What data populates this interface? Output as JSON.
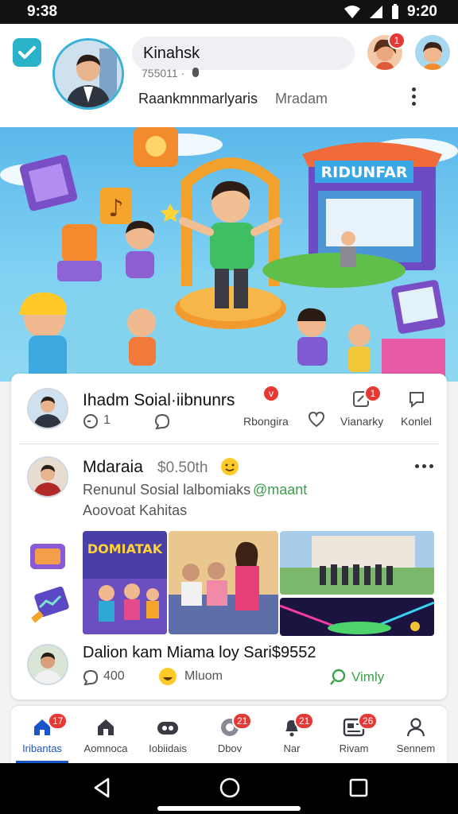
{
  "status_bar": {
    "time_left": "9:38",
    "time_right": "9:20"
  },
  "header": {
    "search_value": "Kinahsk",
    "sub_text": "755011 ·",
    "name": "Raankmnmarlyaris",
    "role": "Mradam",
    "avatar1_badge": "1"
  },
  "banner": {
    "sign": "RIDUNFAR"
  },
  "posts": [
    {
      "title": "Ihadm Soial·iibnunrs",
      "badge": "v",
      "meta_count": "1",
      "action1_label": "Rbongira",
      "action2_label": "Vianarky",
      "action2_badge": "1",
      "action3_label": "Konlel"
    },
    {
      "title": "Mdaraia",
      "title_extra": "$0.50th",
      "line1": "Renunul Sosial lalbomiaks",
      "line1_tag": "@maant",
      "line2": "Aoovoat Kahitas"
    },
    {
      "title": "Dalion kam Miama loy Sari$9552",
      "meta_count": "400",
      "meta_extra": "Mluom",
      "action_label": "Vimly"
    }
  ],
  "media_labels": {
    "poster": "DOMIATAK"
  },
  "bottom_nav": [
    {
      "label": "Iribantas",
      "badge": "17"
    },
    {
      "label": "Aomnoca",
      "badge": ""
    },
    {
      "label": "Iobiidais",
      "badge": ""
    },
    {
      "label": "Dbov",
      "badge": "21"
    },
    {
      "label": "Nar",
      "badge": "21"
    },
    {
      "label": "Rivam",
      "badge": "26"
    },
    {
      "label": "Sennem",
      "badge": ""
    }
  ],
  "colors": {
    "accent": "#1a56c9",
    "badge": "#e53935",
    "green": "#3aa24a",
    "check": "#2ab3c8"
  }
}
